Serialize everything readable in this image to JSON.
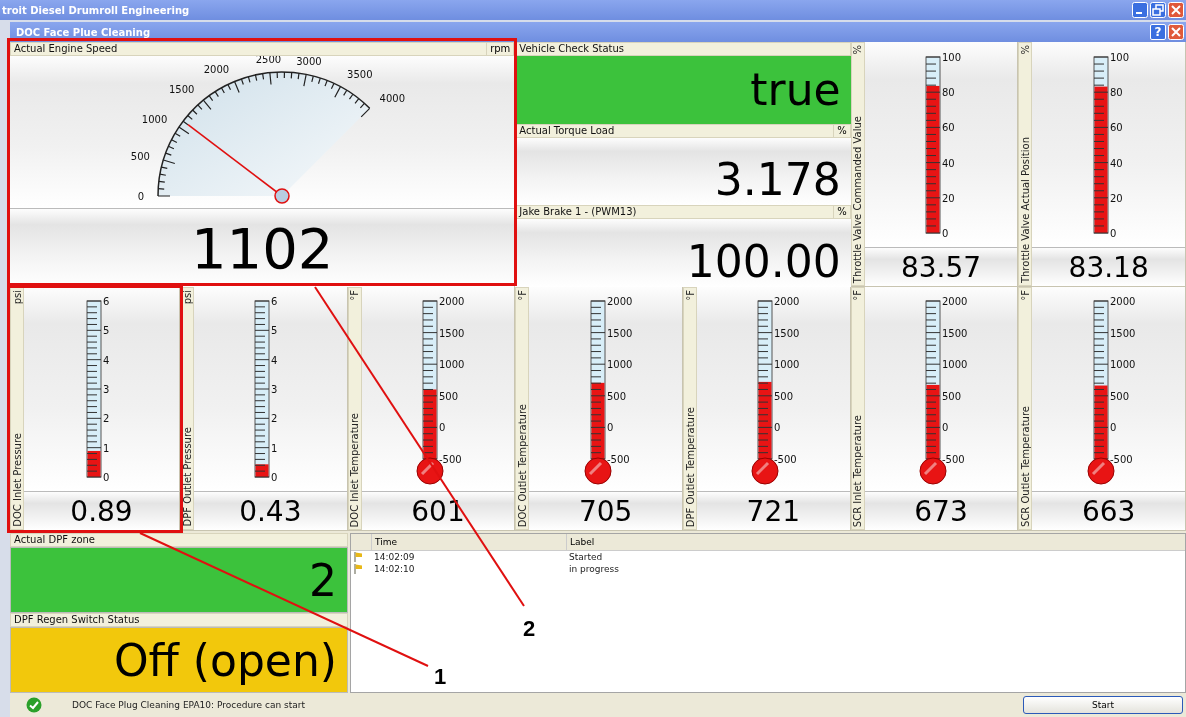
{
  "app_title": "troit Diesel Drumroll Engineering",
  "procedure_title": "DOC Face Plue Cleaning",
  "help_button": "?",
  "engine_speed": {
    "title": "Actual Engine Speed",
    "unit": "rpm",
    "scale": [
      "0",
      "500",
      "1000",
      "1500",
      "2000",
      "2500",
      "3000",
      "3500",
      "4000"
    ],
    "value": "1102"
  },
  "readouts": [
    {
      "kind": "status",
      "title": "Vehicle Check Status",
      "value": "true",
      "color": "#3cc23c"
    },
    {
      "kind": "numeric",
      "title": "Actual Torque Load",
      "unit": "%",
      "value": "3.178"
    },
    {
      "kind": "numeric",
      "title": "Jake Brake 1 - (PWM13)",
      "unit": "%",
      "value": "100.00"
    }
  ],
  "meters": [
    {
      "kind": "tube",
      "label": "Throttle Valve Commanded Value",
      "unit": "%",
      "scale": [
        "100",
        "80",
        "60",
        "40",
        "20",
        "0"
      ],
      "level": 0.8357,
      "value": "83.57"
    },
    {
      "kind": "tube",
      "label": "Throttle Valve Actual Position",
      "unit": "%",
      "scale": [
        "100",
        "80",
        "60",
        "40",
        "20",
        "0"
      ],
      "level": 0.8318,
      "value": "83.18"
    },
    {
      "kind": "tube",
      "label": "DOC Inlet Pressure",
      "unit": "psi",
      "scale": [
        "6",
        "5",
        "4",
        "3",
        "2",
        "1",
        "0"
      ],
      "level": 0.148,
      "value": "0.89"
    },
    {
      "kind": "tube",
      "label": "DPF Outlet Pressure",
      "unit": "psi",
      "scale": [
        "6",
        "5",
        "4",
        "3",
        "2",
        "1",
        "0"
      ],
      "level": 0.072,
      "value": "0.43"
    },
    {
      "kind": "bulb",
      "label": "DOC Inlet Temperature",
      "unit": "°F",
      "scale": [
        "2000",
        "1500",
        "1000",
        "500",
        "0",
        "-500"
      ],
      "level": 0.44,
      "value": "601"
    },
    {
      "kind": "bulb",
      "label": "DOC Outlet Temperature",
      "unit": "°F",
      "scale": [
        "2000",
        "1500",
        "1000",
        "500",
        "0",
        "-500"
      ],
      "level": 0.482,
      "value": "705"
    },
    {
      "kind": "bulb",
      "label": "DPF Outlet Temperature",
      "unit": "°F",
      "scale": [
        "2000",
        "1500",
        "1000",
        "500",
        "0",
        "-500"
      ],
      "level": 0.488,
      "value": "721"
    },
    {
      "kind": "bulb",
      "label": "SCR Inlet Temperature",
      "unit": "°F",
      "scale": [
        "2000",
        "1500",
        "1000",
        "500",
        "0",
        "-500"
      ],
      "level": 0.469,
      "value": "673"
    },
    {
      "kind": "bulb",
      "label": "SCR Outlet Temperature",
      "unit": "°F",
      "scale": [
        "2000",
        "1500",
        "1000",
        "500",
        "0",
        "-500"
      ],
      "level": 0.465,
      "value": "663"
    }
  ],
  "zones": [
    {
      "title": "Actual DPF zone",
      "value": "2",
      "color": "#3cc23c"
    },
    {
      "title": "DPF Regen Switch Status",
      "value": "Off (open)",
      "color": "#f2c80c"
    }
  ],
  "log": {
    "columns": [
      "Time",
      "Label"
    ],
    "rows": [
      {
        "time": "14:02:09",
        "label": "Started"
      },
      {
        "time": "14:02:10",
        "label": "in progress"
      }
    ]
  },
  "status_bar": {
    "message": "DOC Face Plug Cleaning EPA10: Procedure can start",
    "button": "Start"
  },
  "callouts": [
    "1",
    "2"
  ]
}
